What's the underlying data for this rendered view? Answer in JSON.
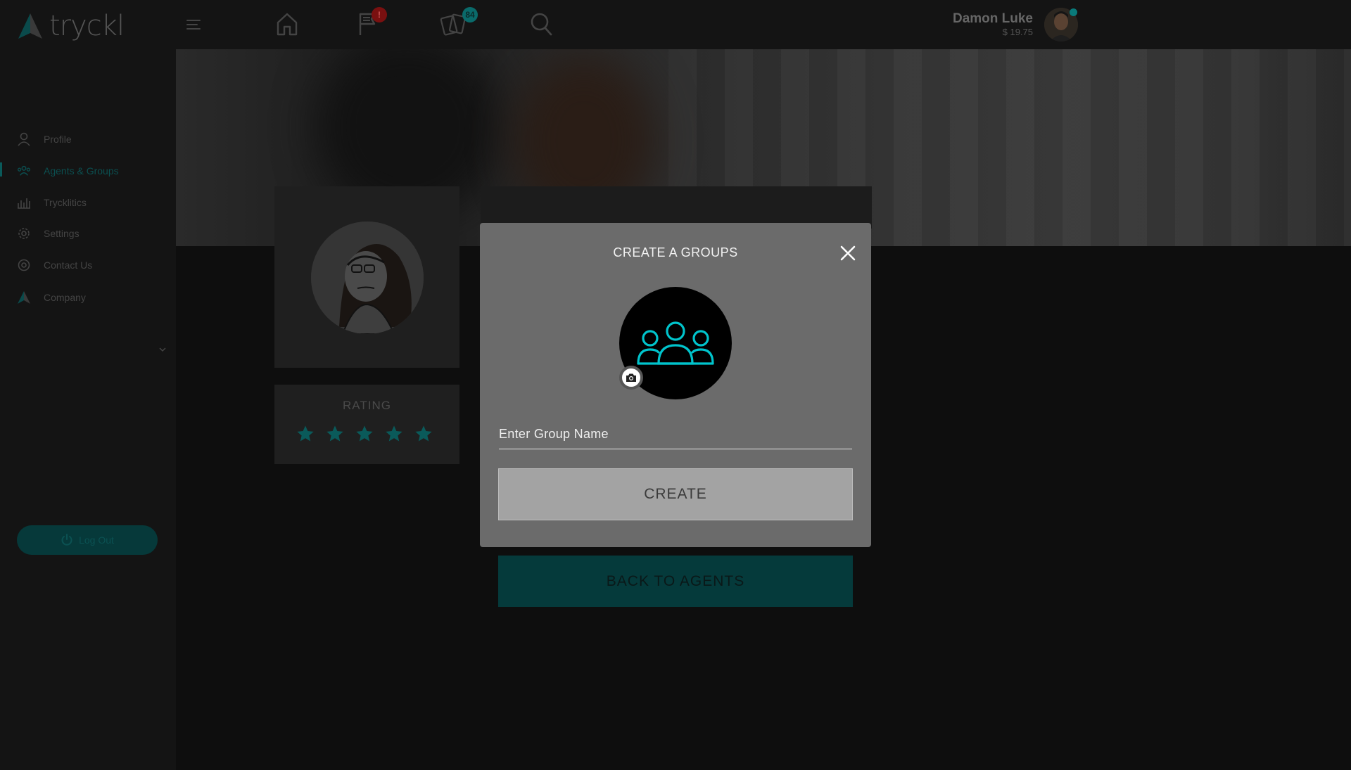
{
  "app": {
    "logo_text": "tryckl"
  },
  "topbar": {
    "icons": [
      "menu-icon",
      "home-icon",
      "flag-icon",
      "cards-icon",
      "search-icon"
    ],
    "notifications_badge": "!",
    "cards_badge": "84",
    "user_name": "Damon Luke",
    "user_balance": "$ 19.75"
  },
  "sidebar": {
    "items": [
      {
        "label": "Profile",
        "icon": "user-icon"
      },
      {
        "label": "Agents & Groups",
        "icon": "groups-icon",
        "active": true
      },
      {
        "label": "Trycklitics",
        "icon": "chart-icon"
      },
      {
        "label": "Settings",
        "icon": "gear-icon"
      },
      {
        "label": "Contact Us",
        "icon": "support-icon"
      },
      {
        "label": "Company",
        "icon": "company-icon"
      }
    ],
    "logout_label": "Log Out"
  },
  "profile": {
    "rating_title": "RATING",
    "rating_value": 5,
    "rating_max": 5
  },
  "back_button_label": "BACK TO AGENTS",
  "modal": {
    "title": "CREATE A GROUPS",
    "input_placeholder": "Enter Group Name",
    "input_value": "",
    "create_label": "CREATE"
  },
  "colors": {
    "accent": "#00c4cc",
    "modal_bg": "#6b6b6b",
    "create_button_bg": "#a3a3a3",
    "star": "#0a5a5a"
  }
}
